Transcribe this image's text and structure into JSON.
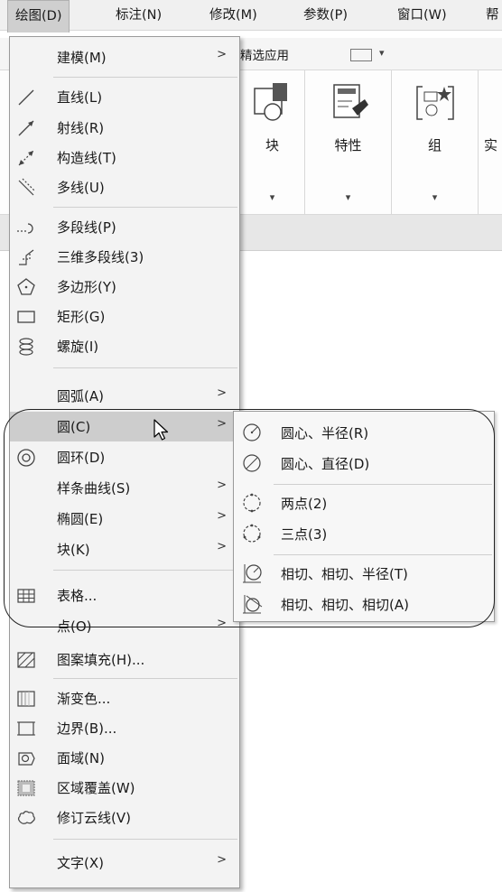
{
  "menubar": {
    "items": [
      {
        "label": "绘图(D)"
      },
      {
        "label": "标注(N)"
      },
      {
        "label": "修改(M)"
      },
      {
        "label": "参数(P)"
      },
      {
        "label": "窗口(W)"
      },
      {
        "label": "帮"
      }
    ]
  },
  "ribbon": {
    "strip_text": "精选应用",
    "panels": [
      {
        "label": "块"
      },
      {
        "label": "特性"
      },
      {
        "label": "组"
      },
      {
        "label": "实"
      }
    ]
  },
  "draw_menu": {
    "items": [
      {
        "label": "建模(M)"
      },
      {
        "label": "直线(L)"
      },
      {
        "label": "射线(R)"
      },
      {
        "label": "构造线(T)"
      },
      {
        "label": "多线(U)"
      },
      {
        "label": "多段线(P)"
      },
      {
        "label": "三维多段线(3)"
      },
      {
        "label": "多边形(Y)"
      },
      {
        "label": "矩形(G)"
      },
      {
        "label": "螺旋(I)"
      },
      {
        "label": "圆弧(A)"
      },
      {
        "label": "圆(C)"
      },
      {
        "label": "圆环(D)"
      },
      {
        "label": "样条曲线(S)"
      },
      {
        "label": "椭圆(E)"
      },
      {
        "label": "块(K)"
      },
      {
        "label": "表格..."
      },
      {
        "label": "点(O)"
      },
      {
        "label": "图案填充(H)..."
      },
      {
        "label": "渐变色..."
      },
      {
        "label": "边界(B)..."
      },
      {
        "label": "面域(N)"
      },
      {
        "label": "区域覆盖(W)"
      },
      {
        "label": "修订云线(V)"
      },
      {
        "label": "文字(X)"
      }
    ]
  },
  "circle_submenu": {
    "items": [
      {
        "label": "圆心、半径(R)"
      },
      {
        "label": "圆心、直径(D)"
      },
      {
        "label": "两点(2)"
      },
      {
        "label": "三点(3)"
      },
      {
        "label": "相切、相切、半径(T)"
      },
      {
        "label": "相切、相切、相切(A)"
      }
    ]
  },
  "submenu_arrow": ">",
  "dropdown_arrow": "▾"
}
